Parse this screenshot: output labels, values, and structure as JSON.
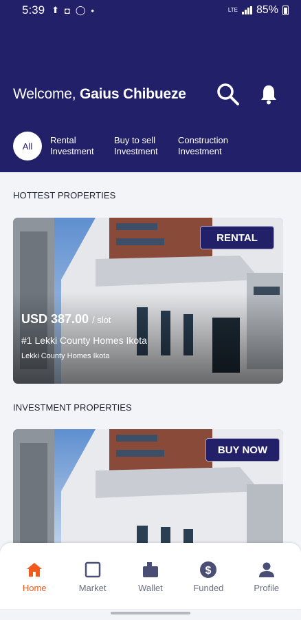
{
  "status_bar": {
    "time": "5:39",
    "network": "LTE",
    "battery": "85%"
  },
  "header": {
    "welcome_prefix": "Welcome,",
    "user_name": "Gaius Chibueze",
    "filters": [
      {
        "label": "All",
        "active": true
      },
      {
        "label": "Rental Investment"
      },
      {
        "label": "Buy to sell Investment"
      },
      {
        "label": "Construction Investment"
      }
    ]
  },
  "sections": {
    "hottest": {
      "title": "HOTTEST PROPERTIES",
      "card": {
        "badge": "RENTAL",
        "price": "USD 387.00",
        "price_unit": "/ slot",
        "name": "#1 Lekki County Homes Ikota",
        "location": "Lekki County Homes Ikota"
      }
    },
    "investment": {
      "title": "INVESTMENT PROPERTIES",
      "card": {
        "badge": "BUY NOW"
      }
    }
  },
  "bottom_nav": {
    "items": [
      {
        "label": "Home",
        "icon": "home-icon",
        "active": true
      },
      {
        "label": "Market",
        "icon": "market-icon"
      },
      {
        "label": "Wallet",
        "icon": "wallet-icon"
      },
      {
        "label": "Funded",
        "icon": "dollar-icon"
      },
      {
        "label": "Profile",
        "icon": "person-icon"
      }
    ]
  },
  "colors": {
    "primary": "#23206a",
    "accent": "#f05a1c",
    "background": "#f3f4f7"
  }
}
